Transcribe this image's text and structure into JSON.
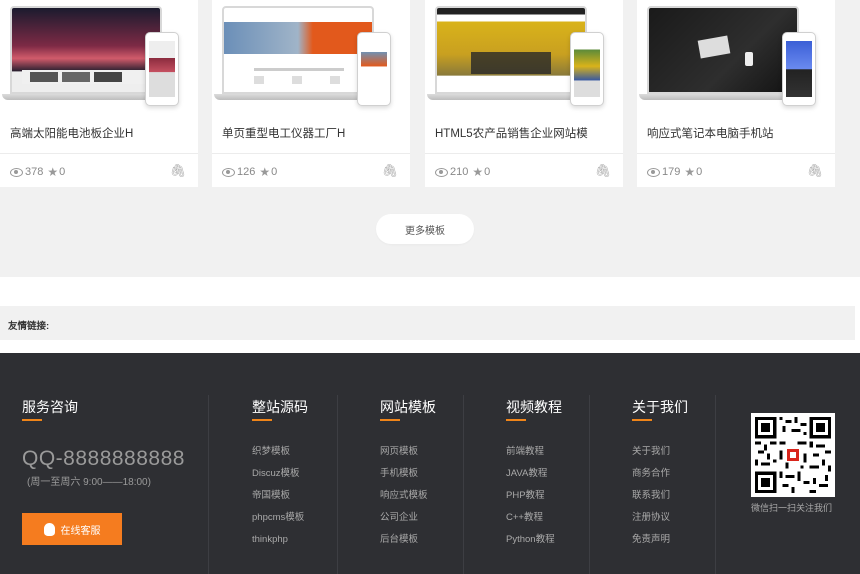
{
  "templates": [
    {
      "title": "高端太阳能电池板企业H",
      "views": "378",
      "stars": "0"
    },
    {
      "title": "单页重型电工仪器工厂H",
      "views": "126",
      "stars": "0"
    },
    {
      "title": "HTML5农产品销售企业网站模",
      "views": "210",
      "stars": "0"
    },
    {
      "title": "响应式笔记本电脑手机站",
      "views": "179",
      "stars": "0"
    }
  ],
  "more_label": "更多模板",
  "friend_links_label": "友情链接:",
  "footer": {
    "service": {
      "title": "服务咨询",
      "qq": "QQ-8888888888",
      "hours": "(周一至周六 9:00——18:00)",
      "button": "在线客服"
    },
    "columns": [
      {
        "title": "整站源码",
        "items": [
          "织梦模板",
          "Discuz模板",
          "帝国模板",
          "phpcms模板",
          "thinkphp"
        ]
      },
      {
        "title": "网站模板",
        "items": [
          "网页模板",
          "手机模板",
          "响应式模板",
          "公司企业",
          "后台模板"
        ]
      },
      {
        "title": "视频教程",
        "items": [
          "前端教程",
          "JAVA教程",
          "PHP教程",
          "C++教程",
          "Python教程"
        ]
      },
      {
        "title": "关于我们",
        "items": [
          "关于我们",
          "商务合作",
          "联系我们",
          "注册协议",
          "免责声明"
        ]
      }
    ],
    "qr_caption": "微信扫一扫关注我们"
  },
  "colors": {
    "accent": "#f57c1f",
    "footer_bg": "#2e2f33"
  }
}
